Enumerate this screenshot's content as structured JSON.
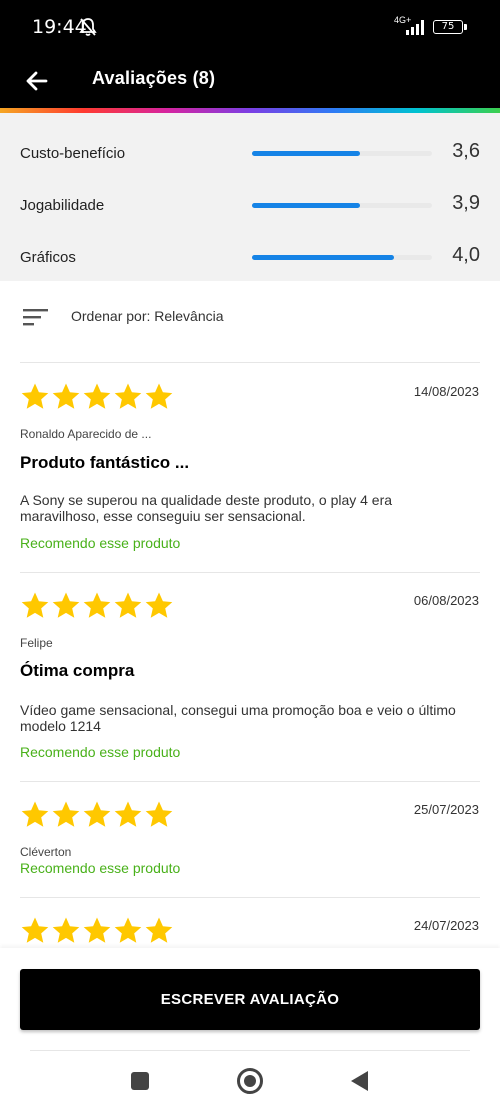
{
  "status_bar": {
    "time": "19:44",
    "network": "4G+",
    "battery": "75"
  },
  "app_bar": {
    "title": "Avaliações (8)"
  },
  "ratings": [
    {
      "label": "Custo-benefício",
      "value": "3,6",
      "fraction": 0.6
    },
    {
      "label": "Jogabilidade",
      "value": "3,9",
      "fraction": 0.6
    },
    {
      "label": "Gráficos",
      "value": "4,0",
      "fraction": 0.79
    }
  ],
  "sort": {
    "label": "Ordenar por: Relevância"
  },
  "reviews": [
    {
      "date": "14/08/2023",
      "author": "Ronaldo Aparecido de ...",
      "title": "Produto fantástico ...",
      "body": "A Sony se superou na qualidade deste produto, o play 4 era maravilhoso, esse conseguiu ser sensacional.",
      "recommend": "Recomendo esse produto",
      "stars": 5
    },
    {
      "date": "06/08/2023",
      "author": "Felipe",
      "title": "Ótima compra",
      "body": "Vídeo game sensacional, consegui uma promoção boa e veio o último modelo 1214",
      "recommend": "Recomendo esse produto",
      "stars": 5
    },
    {
      "date": "25/07/2023",
      "author": "Cléverton",
      "recommend": "Recomendo esse produto",
      "stars": 5
    },
    {
      "date": "24/07/2023",
      "stars": 5
    }
  ],
  "write_button": {
    "label": "ESCREVER AVALIAÇÃO"
  },
  "colors": {
    "accent_bar": "#1583e6",
    "recommend": "#49b11a",
    "star": "#ffc800"
  },
  "icons": {
    "back": "arrow-left-icon",
    "bell": "bell-off-icon",
    "signal": "signal-icon",
    "sort": "sort-lines-icon",
    "star": "star-icon",
    "nav_recents": "square-icon",
    "nav_home": "circle-icon",
    "nav_back": "triangle-back-icon"
  }
}
